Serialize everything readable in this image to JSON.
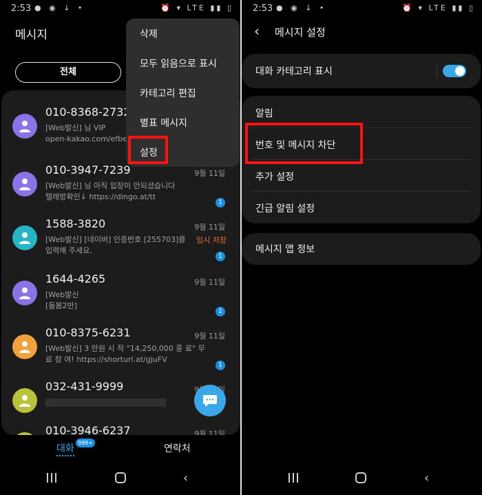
{
  "status_bar": {
    "time": "2:53",
    "network": "LTE"
  },
  "left": {
    "title": "메시지",
    "filter_label": "전체",
    "conversations": [
      {
        "name": "010-8368-2732",
        "preview": "[Web발신]         님 VIP\nopen-kakao.com/efbe",
        "date": "",
        "badge": "",
        "draft": "",
        "avatar_color": "#8b72e6"
      },
      {
        "name": "010-3947-7239",
        "preview": "[Web발신]         님 아직 입장이 안되셨습니다\n텔레방확인↓ https://dingo.at/tt",
        "date": "9월 11일",
        "badge": "1",
        "draft": "",
        "avatar_color": "#8b72e6"
      },
      {
        "name": "1588-3820",
        "preview": "[Web발신] [네이버] 인증번호 [255703]를\n입력해 주세요.",
        "date": "9월 11일",
        "badge": "1",
        "draft": "임시 저장",
        "avatar_color": "#26b5c4"
      },
      {
        "name": "1644-4265",
        "preview": "[Web발신\n[돌봄2반]",
        "date": "9월 11일",
        "badge": "1",
        "draft": "",
        "avatar_color": "#8b72e6"
      },
      {
        "name": "010-8375-6231",
        "preview": "[Web발신] 3 만원 시 작 \"14,250,000 종 료\" 무\n료 참 여! https://shorturl.at/gjuFV",
        "date": "9월 11일",
        "badge": "1",
        "draft": "",
        "avatar_color": "#f2a23c"
      },
      {
        "name": "032-431-9999",
        "preview": "",
        "date": "9월 11일",
        "badge": "",
        "draft": "",
        "avatar_color": "#b8c23a"
      },
      {
        "name": "010-3946-6237",
        "preview": "",
        "date": "9월 11일",
        "badge": "",
        "draft": "",
        "avatar_color": "#b8c23a"
      }
    ],
    "menu": [
      "삭제",
      "모두 읽음으로 표시",
      "카테고리 편집",
      "별표 메시지",
      "설정"
    ],
    "tabs": {
      "chats": "대화",
      "chats_badge": "999+",
      "contacts": "연락처"
    }
  },
  "right": {
    "title": "메시지 설정",
    "category_toggle_label": "대화 카테고리 표시",
    "category_toggle_on": true,
    "notifications": "알림",
    "block": "번호 및 메시지 차단",
    "more_settings": "추가 설정",
    "emergency_alerts": "긴급 알림 설정",
    "about": "메시지 앱 정보"
  },
  "colors": {
    "accent": "#3aa8e8",
    "highlight_box": "#ff1212",
    "draft": "#e0743a",
    "background": "#000000",
    "card": "#1c1c1c"
  }
}
